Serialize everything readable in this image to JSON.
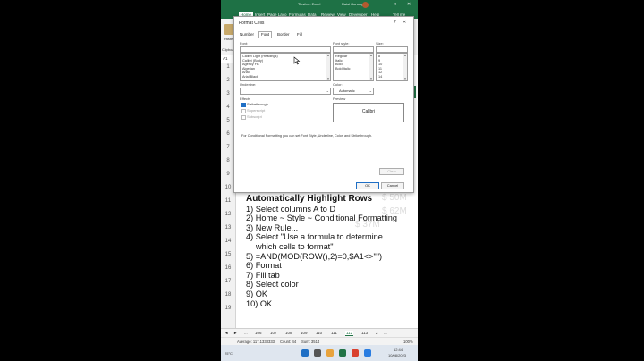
{
  "window": {
    "title": "Tipsfor - Excel",
    "user": "Raisi Gunung",
    "controls": [
      "–",
      "□",
      "✕"
    ]
  },
  "ribbon": {
    "tabs": [
      "Home",
      "Insert",
      "Page Layo",
      "Formulas",
      "Data",
      "Review",
      "View",
      "Developer",
      "Help",
      "Tell me"
    ],
    "paste_label": "Paste",
    "clipboard_label": "Clipboa"
  },
  "namebox": {
    "value": "A1"
  },
  "rows": [
    "1",
    "2",
    "3",
    "4",
    "5",
    "6",
    "7",
    "8",
    "9",
    "10",
    "11",
    "12",
    "13",
    "14",
    "15",
    "16",
    "17",
    "18",
    "19"
  ],
  "ghost_values": [
    "$ 50M",
    "$ 62M",
    "$ 37M"
  ],
  "dialog": {
    "title": "Format Cells",
    "help": "?",
    "close": "✕",
    "tabs": [
      "Number",
      "Font",
      "Border",
      "Fill"
    ],
    "active_tab": "Font",
    "font_label": "Font:",
    "font_style_label": "Font style:",
    "size_label": "Size:",
    "fonts": [
      "Calibri Light (Headings)",
      "Calibri (Body)",
      "Agency FB",
      "Algerian",
      "Arial",
      "Arial Black"
    ],
    "styles": [
      "Regular",
      "Italic",
      "Bold",
      "Bold Italic"
    ],
    "sizes": [
      "8",
      "9",
      "10",
      "11",
      "12",
      "14"
    ],
    "underline_label": "Underline:",
    "color_label": "Color:",
    "color_value": "Automatic",
    "effects_label": "Effects",
    "effects": [
      {
        "label": "Strikethrough",
        "checked": true,
        "enabled": true
      },
      {
        "label": "Superscript",
        "checked": false,
        "enabled": false
      },
      {
        "label": "Subscript",
        "checked": false,
        "enabled": false
      }
    ],
    "preview_label": "Preview",
    "preview_text": "Calibri",
    "note": "For Conditional Formatting you can set Font Style, Underline, Color, and Strikethrough.",
    "clear_label": "Clear",
    "ok_label": "OK",
    "cancel_label": "Cancel"
  },
  "overlay": {
    "heading": "Automatically Highlight Rows",
    "steps": [
      "1) Select columns A to D",
      "2) Home ~ Style ~ Conditional Formatting",
      "3) New Rule...",
      "4) Select \"Use a formula to determine",
      "which cells to format\"",
      "5) =AND(MOD(ROW(),2)=0,$A1<>\"\")",
      "6) Format",
      "7) Fill tab",
      "8) Select color",
      "9) OK",
      "10) OK"
    ]
  },
  "sheet_tabs": [
    "◄",
    "►",
    "...",
    "106",
    "107",
    "108",
    "109",
    "110",
    "111",
    "112",
    "113",
    "2",
    "..."
  ],
  "active_sheet": "112",
  "status": {
    "average": "Average: 117.1333333",
    "count": "Count: 44",
    "sum": "Sum: 3514",
    "zoom": "100%"
  },
  "taskbar": {
    "weather": "25°C",
    "time": "12:44",
    "date": "10/08/2023"
  }
}
